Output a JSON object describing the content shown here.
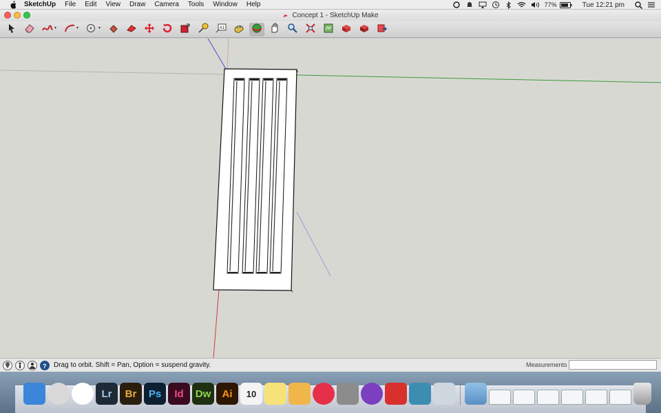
{
  "menubar": {
    "app_name": "SketchUp",
    "items": [
      "File",
      "Edit",
      "View",
      "Draw",
      "Camera",
      "Tools",
      "Window",
      "Help"
    ],
    "battery": "77%",
    "clock": "Tue 12:21 pm"
  },
  "window": {
    "title": "Concept 1 - SketchUp Make"
  },
  "toolbar": {
    "tools": [
      "select-tool",
      "eraser-tool",
      "freehand-tool",
      "arc-tool",
      "shape-tool",
      "paint-bucket-tool",
      "push-pull-tool",
      "move-tool",
      "rotate-tool",
      "scale-tool",
      "tape-measure-tool",
      "text-tool",
      "paint-tool",
      "orbit-tool",
      "pan-tool",
      "zoom-tool",
      "zoom-extents-tool",
      "3d-warehouse-tool",
      "extension-warehouse-tool",
      "layout-tool",
      "send-to-layout-tool"
    ]
  },
  "statusbar": {
    "hint": "Drag to orbit. Shift = Pan, Option = suspend gravity.",
    "measurements_label": "Measurements",
    "measurements_value": ""
  },
  "dock": {
    "apps": [
      {
        "name": "finder",
        "label": "",
        "bg": "#3b86d8",
        "fg": "#ffffff"
      },
      {
        "name": "launchpad",
        "label": "",
        "bg": "#d9d9d9",
        "fg": "#333333"
      },
      {
        "name": "chrome",
        "label": "",
        "bg": "#ffffff",
        "fg": "#333333"
      },
      {
        "name": "lightroom",
        "label": "Lr",
        "bg": "#1e2a36",
        "fg": "#a9c8e6"
      },
      {
        "name": "bridge",
        "label": "Br",
        "bg": "#2a1e0e",
        "fg": "#e8a93c"
      },
      {
        "name": "photoshop",
        "label": "Ps",
        "bg": "#0c2032",
        "fg": "#4fb3f0"
      },
      {
        "name": "indesign",
        "label": "Id",
        "bg": "#3a0b1f",
        "fg": "#f0488e"
      },
      {
        "name": "dreamweaver",
        "label": "Dw",
        "bg": "#1e3011",
        "fg": "#8fd14f"
      },
      {
        "name": "illustrator",
        "label": "Ai",
        "bg": "#2e1700",
        "fg": "#f7941d"
      },
      {
        "name": "calendar",
        "label": "10",
        "bg": "#f4f4f4",
        "fg": "#222222"
      },
      {
        "name": "stickies",
        "label": "",
        "bg": "#f7e27a",
        "fg": "#333333"
      },
      {
        "name": "pages",
        "label": "",
        "bg": "#f0b64a",
        "fg": "#ffffff"
      },
      {
        "name": "itunes",
        "label": "",
        "bg": "#e6304a",
        "fg": "#ffffff"
      },
      {
        "name": "system-preferences",
        "label": "",
        "bg": "#8c8c8c",
        "fg": "#ffffff"
      },
      {
        "name": "vlc-player",
        "label": "",
        "bg": "#7b3fbf",
        "fg": "#ffffff"
      },
      {
        "name": "sketchup",
        "label": "",
        "bg": "#d8302d",
        "fg": "#ffffff"
      },
      {
        "name": "messages-app",
        "label": "",
        "bg": "#3d8cb2",
        "fg": "#ffffff"
      },
      {
        "name": "stickies-alt",
        "label": "",
        "bg": "#cfd7df",
        "fg": "#333333"
      }
    ],
    "stacks": [
      "applications-folder",
      "downloads-stack",
      "screenshot-1",
      "screenshot-2",
      "screenshot-3",
      "screenshot-4",
      "screenshot-5",
      "trash"
    ]
  },
  "colors": {
    "viewport_bg": "#d8d8d3",
    "axis_red": "#cc3b3b",
    "axis_green": "#3a9a3a",
    "axis_blue": "#4a4ad0"
  }
}
